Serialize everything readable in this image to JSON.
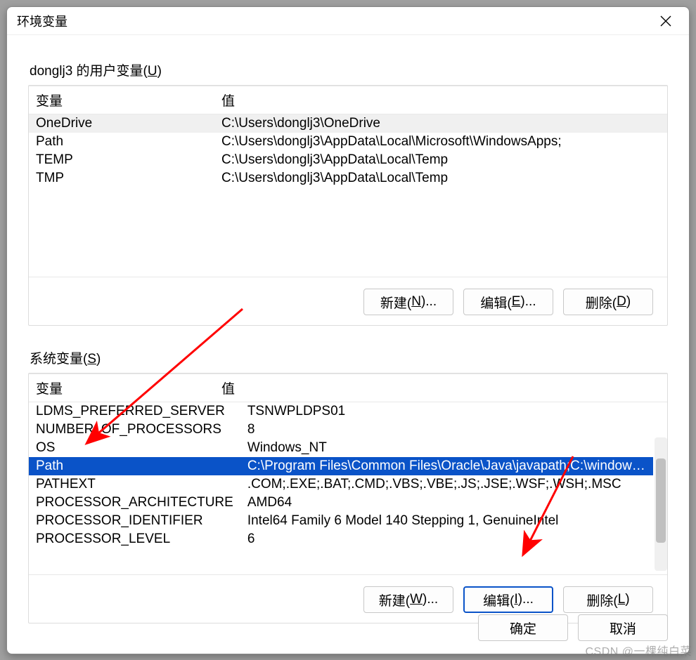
{
  "title": "环境变量",
  "user_section": {
    "label_prefix": "donglj3 的用户变量(",
    "label_key": "U",
    "label_suffix": ")",
    "columns": {
      "name": "变量",
      "value": "值"
    },
    "rows": [
      {
        "name": "OneDrive",
        "value": "C:\\Users\\donglj3\\OneDrive",
        "selected": true
      },
      {
        "name": "Path",
        "value": "C:\\Users\\donglj3\\AppData\\Local\\Microsoft\\WindowsApps;"
      },
      {
        "name": "TEMP",
        "value": "C:\\Users\\donglj3\\AppData\\Local\\Temp"
      },
      {
        "name": "TMP",
        "value": "C:\\Users\\donglj3\\AppData\\Local\\Temp"
      }
    ],
    "buttons": {
      "new": {
        "pre": "新建(",
        "key": "N",
        "post": ")..."
      },
      "edit": {
        "pre": "编辑(",
        "key": "E",
        "post": ")..."
      },
      "delete": {
        "pre": "删除(",
        "key": "D",
        "post": ")"
      }
    }
  },
  "system_section": {
    "label_prefix": "系统变量(",
    "label_key": "S",
    "label_suffix": ")",
    "columns": {
      "name": "变量",
      "value": "值"
    },
    "rows": [
      {
        "name": "LDMS_PREFERRED_SERVER",
        "value": "TSNWPLDPS01"
      },
      {
        "name": "NUMBER_OF_PROCESSORS",
        "value": "8"
      },
      {
        "name": "OS",
        "value": "Windows_NT"
      },
      {
        "name": "Path",
        "value": "C:\\Program Files\\Common Files\\Oracle\\Java\\javapath;C:\\windows\\...",
        "selblue": true
      },
      {
        "name": "PATHEXT",
        "value": ".COM;.EXE;.BAT;.CMD;.VBS;.VBE;.JS;.JSE;.WSF;.WSH;.MSC"
      },
      {
        "name": "PROCESSOR_ARCHITECTURE",
        "value": "AMD64"
      },
      {
        "name": "PROCESSOR_IDENTIFIER",
        "value": "Intel64 Family 6 Model 140 Stepping 1, GenuineIntel"
      },
      {
        "name": "PROCESSOR_LEVEL",
        "value": "6"
      }
    ],
    "buttons": {
      "new": {
        "pre": "新建(",
        "key": "W",
        "post": ")..."
      },
      "edit": {
        "pre": "编辑(",
        "key": "I",
        "post": ")..."
      },
      "delete": {
        "pre": "删除(",
        "key": "L",
        "post": ")"
      }
    }
  },
  "footer": {
    "ok": "确定",
    "cancel": "取消"
  },
  "watermark": "CSDN @一棵纯白菜"
}
